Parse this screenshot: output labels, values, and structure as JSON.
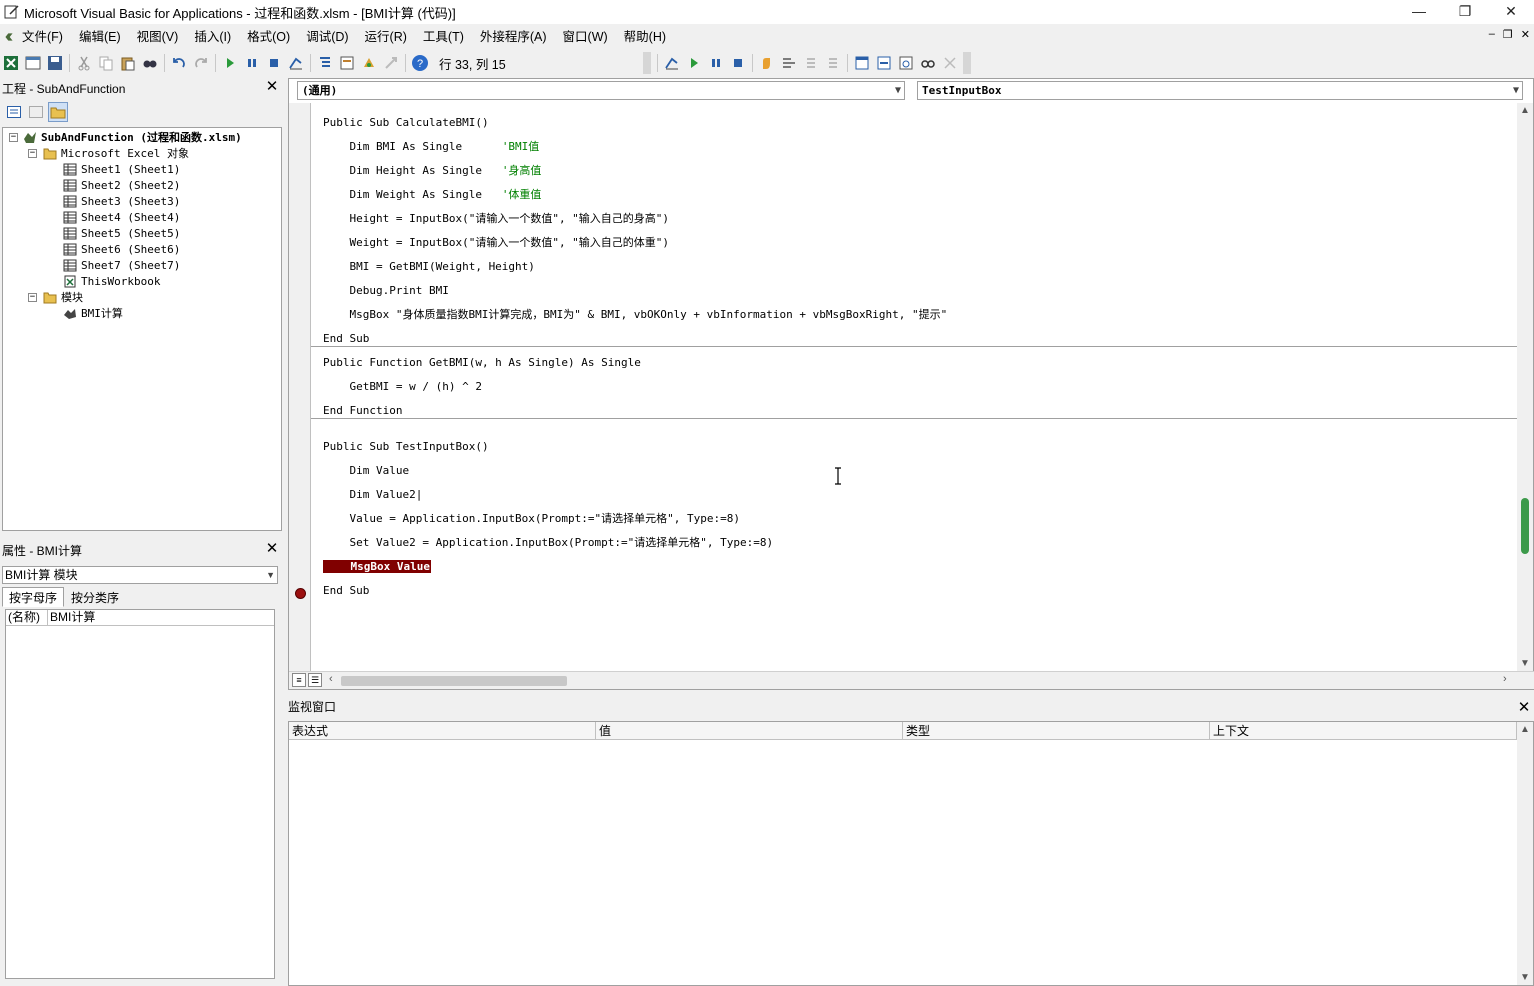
{
  "window": {
    "title": "Microsoft Visual Basic for Applications - 过程和函数.xlsm - [BMI计算 (代码)]",
    "controls": [
      "—",
      "❐",
      "✕"
    ]
  },
  "menu": [
    "文件(F)",
    "编辑(E)",
    "视图(V)",
    "插入(I)",
    "格式(O)",
    "调试(D)",
    "运行(R)",
    "工具(T)",
    "外接程序(A)",
    "窗口(W)",
    "帮助(H)"
  ],
  "mdi_controls": [
    "–",
    "❐",
    "✕"
  ],
  "toolbar": {
    "position": "行 33, 列 15"
  },
  "project": {
    "title": "工程 - SubAndFunction",
    "close": "✕",
    "tree": [
      {
        "label": "SubAndFunction (过程和函数.xlsm)",
        "icon": "vba-project-icon",
        "bold": true
      },
      {
        "label": "Microsoft Excel 对象",
        "icon": "folder-icon"
      },
      {
        "label": "Sheet1 (Sheet1)",
        "icon": "sheet-icon"
      },
      {
        "label": "Sheet2 (Sheet2)",
        "icon": "sheet-icon"
      },
      {
        "label": "Sheet3 (Sheet3)",
        "icon": "sheet-icon"
      },
      {
        "label": "Sheet4 (Sheet4)",
        "icon": "sheet-icon"
      },
      {
        "label": "Sheet5 (Sheet5)",
        "icon": "sheet-icon"
      },
      {
        "label": "Sheet6 (Sheet6)",
        "icon": "sheet-icon"
      },
      {
        "label": "Sheet7 (Sheet7)",
        "icon": "sheet-icon"
      },
      {
        "label": "ThisWorkbook",
        "icon": "workbook-icon"
      },
      {
        "label": "模块",
        "icon": "folder-icon"
      },
      {
        "label": "BMI计算",
        "icon": "module-icon"
      }
    ]
  },
  "properties": {
    "title": "属性 - BMI计算",
    "close": "✕",
    "object": "BMI计算 模块",
    "tabs": [
      "按字母序",
      "按分类序"
    ],
    "rows": [
      {
        "key": "(名称)",
        "value": "BMI计算"
      }
    ]
  },
  "code": {
    "object_combo": "(通用)",
    "proc_combo": "TestInputBox",
    "lines": [
      {
        "text": "Public Sub CalculateBMI()",
        "comment": ""
      },
      {
        "text": "    Dim BMI As Single      ",
        "comment": "'BMI值"
      },
      {
        "text": "    Dim Height As Single   ",
        "comment": "'身高值"
      },
      {
        "text": "    Dim Weight As Single   ",
        "comment": "'体重值"
      },
      {
        "text": "    Height = InputBox(\"请输入一个数值\", \"输入自己的身高\")",
        "comment": ""
      },
      {
        "text": "    Weight = InputBox(\"请输入一个数值\", \"输入自己的体重\")",
        "comment": ""
      },
      {
        "text": "    BMI = GetBMI(Weight, Height)",
        "comment": ""
      },
      {
        "text": "    Debug.Print BMI",
        "comment": ""
      },
      {
        "text": "    MsgBox \"身体质量指数BMI计算完成，BMI为\" & BMI, vbOKOnly + vbInformation + vbMsgBoxRight, \"提示\"",
        "comment": ""
      },
      {
        "text": "End Sub",
        "comment": ""
      },
      {
        "text": "Public Function GetBMI(w, h As Single) As Single",
        "comment": ""
      },
      {
        "text": "    GetBMI = w / (h) ^ 2",
        "comment": ""
      },
      {
        "text": "End Function",
        "comment": ""
      },
      {
        "text": "",
        "comment": ""
      },
      {
        "text": "Public Sub TestInputBox()",
        "comment": ""
      },
      {
        "text": "    Dim Value",
        "comment": ""
      },
      {
        "text": "    Dim Value2|",
        "comment": ""
      },
      {
        "text": "    Value = Application.InputBox(Prompt:=\"请选择单元格\", Type:=8)",
        "comment": ""
      },
      {
        "text": "    Set Value2 = Application.InputBox(Prompt:=\"请选择单元格\", Type:=8)",
        "comment": ""
      },
      {
        "text": "    MsgBox Value",
        "comment": "",
        "breakpoint": true
      },
      {
        "text": "End Sub",
        "comment": ""
      }
    ]
  },
  "watch": {
    "title": "监视窗口",
    "close": "✕",
    "columns": [
      "表达式",
      "值",
      "类型",
      "上下文"
    ]
  }
}
